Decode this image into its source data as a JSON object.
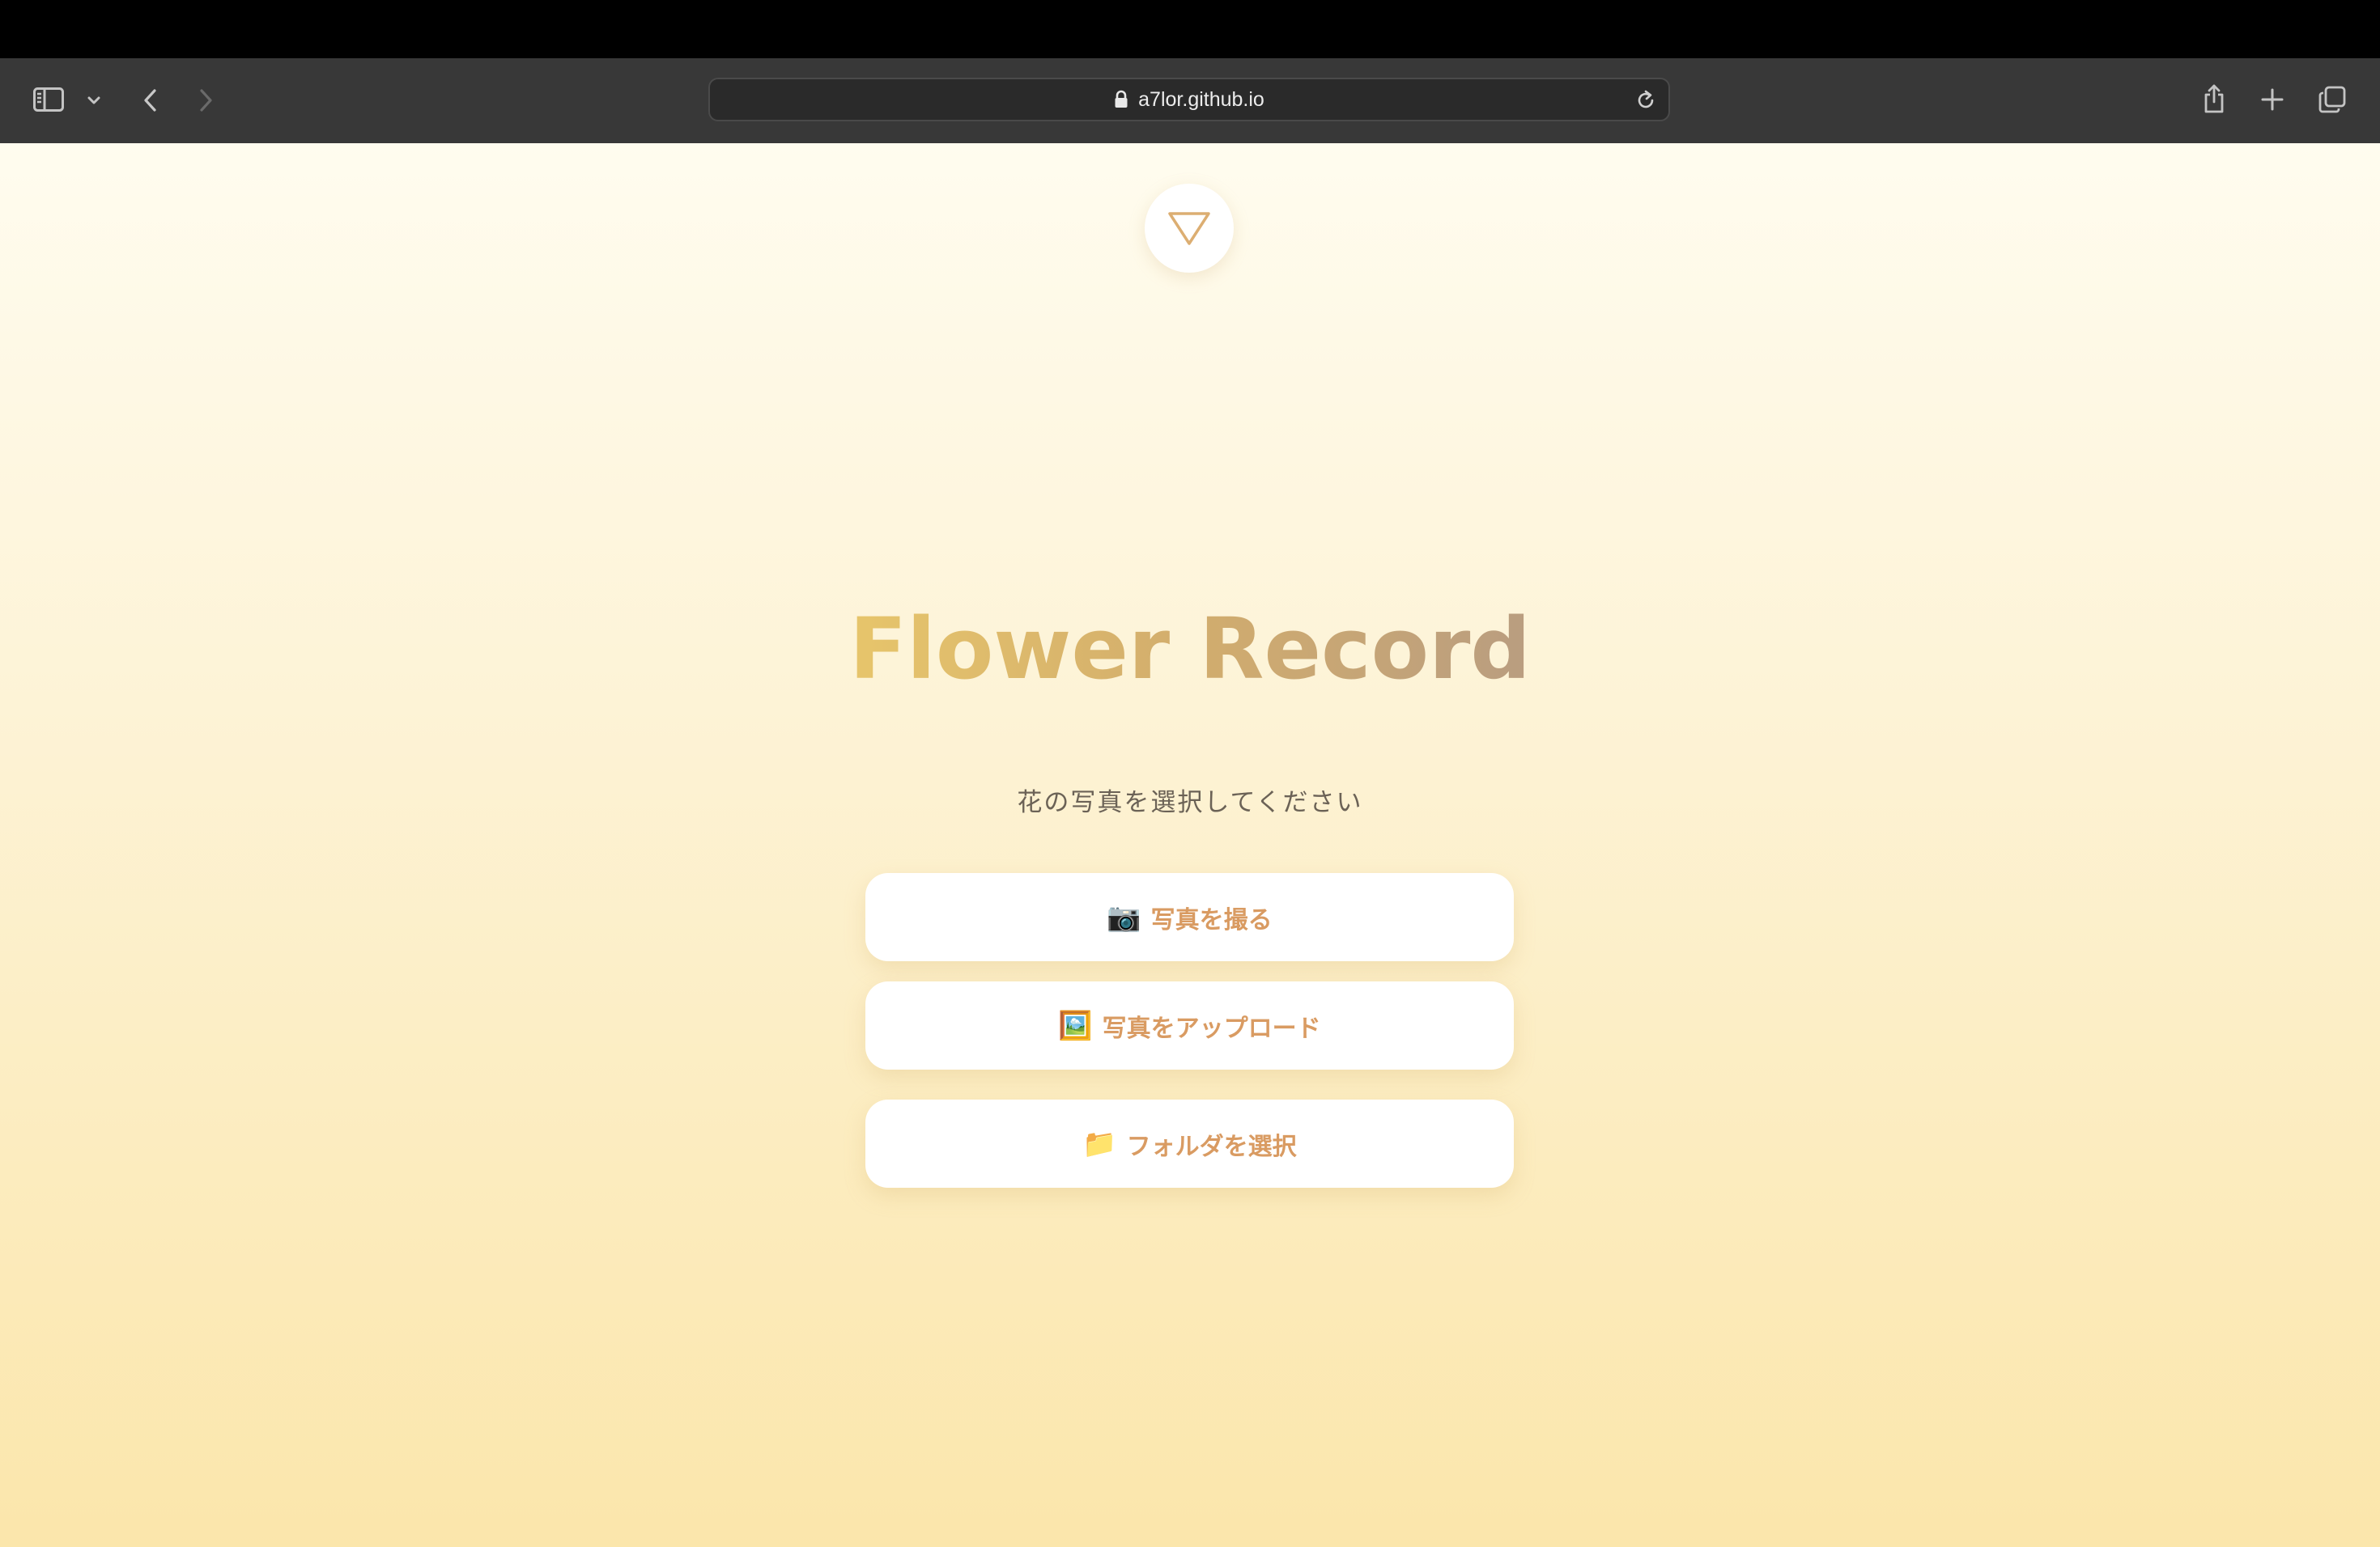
{
  "browser": {
    "url": "a7lor.github.io"
  },
  "page": {
    "title": "Flower Record",
    "subtitle": "花の写真を選択してください",
    "buttons": [
      {
        "emoji": "📷",
        "label": "写真を撮る"
      },
      {
        "emoji": "🖼️",
        "label": "写真をアップロード"
      },
      {
        "emoji": "📁",
        "label": "フォルダを選択"
      }
    ]
  },
  "colors": {
    "accent": "#d99b62",
    "title_gradient_start": "#e7c56b",
    "title_gradient_end": "#b99d80",
    "background_top": "#fffcef",
    "background_bottom": "#fbe6ab"
  },
  "icons": {
    "toolbar": [
      "sidebar-icon",
      "chevron-down-icon",
      "back-icon",
      "forward-icon",
      "lock-icon",
      "reload-icon",
      "share-icon",
      "new-tab-icon",
      "tab-overview-icon"
    ],
    "page": [
      "triangle-down-icon",
      "camera-icon",
      "picture-icon",
      "folder-icon"
    ]
  }
}
